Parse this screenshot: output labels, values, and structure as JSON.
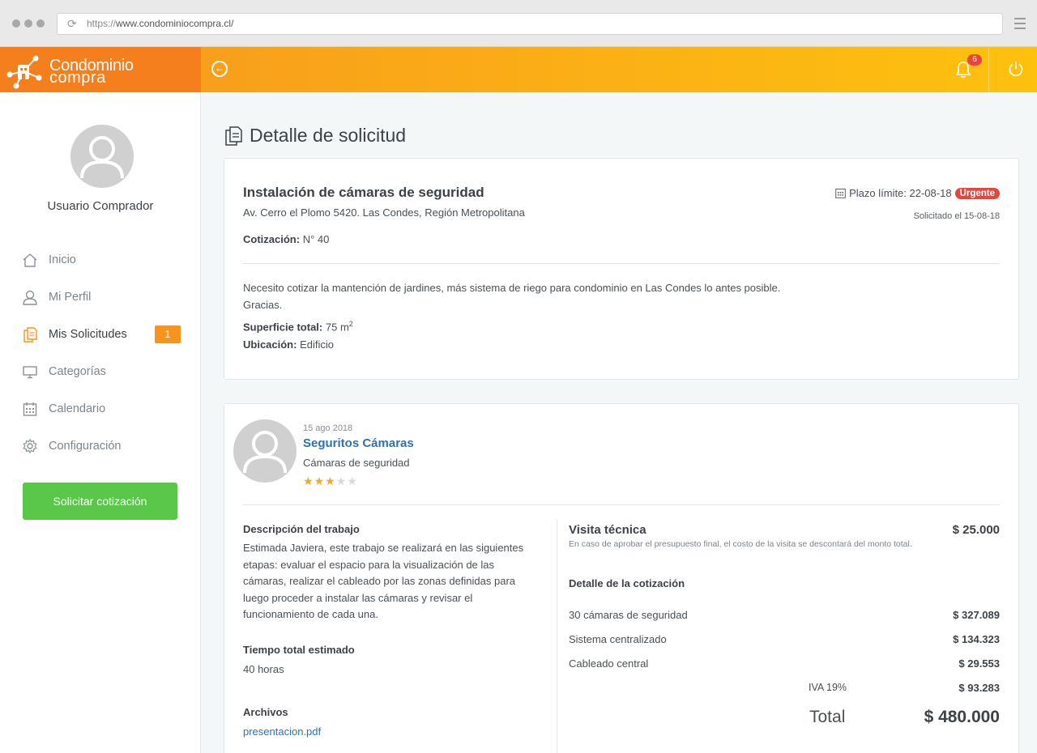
{
  "browser": {
    "url_protocol": "https://",
    "url_host": "www.condominiocompra.cl/"
  },
  "brand": {
    "name_line1": "Condominio",
    "name_line2": "compra",
    "colors": {
      "orange": "#f47f1c",
      "yellow": "#fec10e",
      "green": "#5ac64a",
      "red": "#e8453c",
      "link": "#2a73b4"
    }
  },
  "header": {
    "notifications_count": "6",
    "icons": [
      "back-arrow-icon",
      "bell-icon",
      "power-icon"
    ]
  },
  "sidebar": {
    "user_name": "Usuario Comprador",
    "items": [
      {
        "label": "Inicio",
        "icon": "home-icon"
      },
      {
        "label": "Mi Perfil",
        "icon": "user-icon"
      },
      {
        "label": "Mis Solicitudes",
        "icon": "documents-icon",
        "badge": "1",
        "active": true
      },
      {
        "label": "Categorías",
        "icon": "monitor-icon"
      },
      {
        "label": "Calendario",
        "icon": "calendar-icon"
      },
      {
        "label": "Configuración",
        "icon": "gear-icon"
      }
    ],
    "cta_label": "Solicitar cotización"
  },
  "page": {
    "title": "Detalle de solicitud"
  },
  "request": {
    "title": "Instalación de cámaras de seguridad",
    "address": "Av. Cerro el Plomo 5420. Las Condes, Región Metropolitana",
    "quote_label": "Cotización:",
    "quote_value": "N° 40",
    "deadline_label": "Plazo límite: 22-08-18",
    "urgent_label": "Urgente",
    "requested": "Solicitado el 15-08-18",
    "description_line1": "Necesito cotizar la mantención de jardines, más sistema de riego para condominio en Las Condes lo antes posible.",
    "description_line2": "Gracias.",
    "surface_label": "Superficie total:",
    "surface_value": "75 m",
    "surface_sup": "2",
    "location_label": "Ubicación:",
    "location_value": "Edificio"
  },
  "provider": {
    "date": "15 ago 2018",
    "name": "Seguritos Cámaras",
    "category": "Cámaras de seguridad",
    "rating": 3,
    "rating_max": 5
  },
  "quote": {
    "work_desc_label": "Descripción del trabajo",
    "work_desc_lines": [
      "Estimada Javiera, este trabajo se realizará en las siguientes",
      "etapas: evaluar el espacio para la visualización de las",
      "cámaras, realizar el cableado por las zonas definidas para",
      "luego proceder a instalar las cámaras y revisar el",
      "funcionamiento de cada una."
    ],
    "time_label": "Tiempo total estimado",
    "time_value": "40 horas",
    "files_label": "Archivos",
    "file_name": "presentacion.pdf",
    "visit_title": "Visita técnica",
    "visit_price": "$ 25.000",
    "visit_note": "En caso de aprobar el presupuesto final, el costo de la visita se descontará del monto total.",
    "detail_title": "Detalle de la cotización",
    "items": [
      {
        "label": "30 cámaras de seguridad",
        "amount": "$ 327.089"
      },
      {
        "label": "Sistema centralizado",
        "amount": "$ 134.323"
      },
      {
        "label": "Cableado central",
        "amount": "$ 29.553"
      }
    ],
    "iva_label": "IVA 19%",
    "iva_amount": "$ 93.283",
    "total_label": "Total",
    "total_amount": "$ 480.000"
  }
}
